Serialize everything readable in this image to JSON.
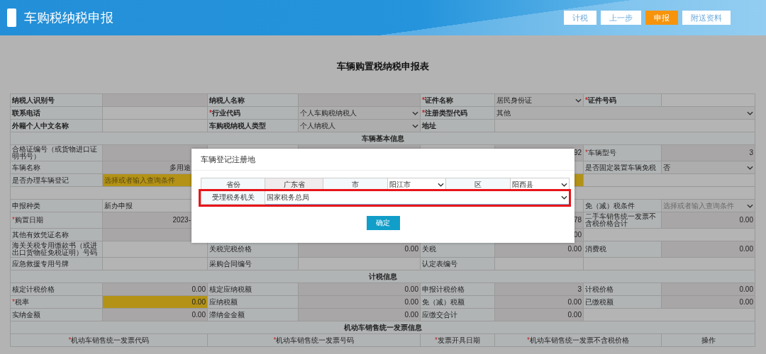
{
  "header": {
    "title": "车购税纳税申报",
    "buttons": [
      {
        "label": "计税",
        "primary": false
      },
      {
        "label": "上一步",
        "primary": false
      },
      {
        "label": "申报",
        "primary": true
      },
      {
        "label": "附送资料",
        "primary": false
      }
    ]
  },
  "form": {
    "title": "车辆购置税纳税申报表",
    "rows": [
      {
        "kind": "quad",
        "cells": [
          {
            "kind": "label",
            "text": "纳税人识别号",
            "bold": true
          },
          {
            "kind": "value",
            "readonly": true
          },
          {
            "kind": "label",
            "text": "纳税人名称",
            "bold": true
          },
          {
            "kind": "value",
            "readonly": true
          },
          {
            "kind": "label",
            "mark": "*",
            "text": "证件名称",
            "bold": true
          },
          {
            "kind": "dropdown",
            "text": "居民身份证"
          },
          {
            "kind": "label",
            "mark": "*",
            "text": "证件号码",
            "bold": true
          },
          {
            "kind": "value"
          }
        ]
      },
      {
        "kind": "tail3",
        "cells": [
          {
            "kind": "label",
            "text": "联系电话",
            "bold": true
          },
          {
            "kind": "value"
          },
          {
            "kind": "label",
            "mark": "*",
            "text": "行业代码",
            "bold": true
          },
          {
            "kind": "dropdown",
            "text": "个人车购税纳税人"
          },
          {
            "kind": "label",
            "mark": "*",
            "text": "注册类型代码",
            "bold": true
          },
          {
            "kind": "dropdown",
            "text": "其他"
          }
        ]
      },
      {
        "kind": "tail3",
        "cells": [
          {
            "kind": "label",
            "text": "外籍个人中文名称",
            "bold": true
          },
          {
            "kind": "value"
          },
          {
            "kind": "label",
            "text": "车购税纳税人类型",
            "bold": true
          },
          {
            "kind": "dropdown",
            "text": "个人纳税人"
          },
          {
            "kind": "label",
            "text": "地址",
            "bold": true
          },
          {
            "kind": "value"
          }
        ]
      },
      {
        "kind": "full",
        "cells": [
          {
            "kind": "section",
            "text": "车辆基本信息"
          }
        ]
      },
      {
        "kind": "quad",
        "cells": [
          {
            "kind": "label",
            "text": "合格证编号（或货物进口证明书号）"
          },
          {
            "kind": "value",
            "readonly": true
          },
          {
            "kind": "value"
          },
          {
            "kind": "value",
            "readonly": true
          },
          {
            "kind": "value"
          },
          {
            "kind": "value",
            "readonly": true,
            "text": "92"
          },
          {
            "kind": "label",
            "mark": "*",
            "text": "车辆型号"
          },
          {
            "kind": "value",
            "readonly": true,
            "text": "3"
          }
        ]
      },
      {
        "kind": "quad",
        "cells": [
          {
            "kind": "label",
            "text": "车辆名称"
          },
          {
            "kind": "value",
            "readonly": true,
            "text": "多用途",
            "under_dialog": true
          },
          {
            "kind": "value"
          },
          {
            "kind": "value"
          },
          {
            "kind": "value"
          },
          {
            "kind": "value"
          },
          {
            "kind": "label",
            "text": "是否固定装置车辆免税"
          },
          {
            "kind": "dropdown",
            "text": "否"
          }
        ]
      },
      {
        "kind": "wide_mid",
        "cells": [
          {
            "kind": "label",
            "text": "是否办理车辆登记"
          },
          {
            "kind": "value",
            "highlight": true,
            "placeholder": "选择或者输入查询条件"
          },
          {
            "kind": "value"
          }
        ]
      },
      {
        "kind": "full",
        "cells": [
          {
            "kind": "value"
          }
        ]
      },
      {
        "kind": "quad",
        "cells": [
          {
            "kind": "label",
            "text": "申报种类"
          },
          {
            "kind": "value",
            "text": "新办申报"
          },
          {
            "kind": "value"
          },
          {
            "kind": "value"
          },
          {
            "kind": "value"
          },
          {
            "kind": "value"
          },
          {
            "kind": "label",
            "text": "免（减）税条件"
          },
          {
            "kind": "dropdown",
            "placeholder": "选择或者输入查询条件"
          }
        ]
      },
      {
        "kind": "quad",
        "cells": [
          {
            "kind": "label",
            "mark": "*",
            "text": "购置日期"
          },
          {
            "kind": "value",
            "readonly": true,
            "text": "2023-",
            "under_dialog": true
          },
          {
            "kind": "value"
          },
          {
            "kind": "value"
          },
          {
            "kind": "value"
          },
          {
            "kind": "value",
            "readonly": true,
            "text": "78"
          },
          {
            "kind": "label",
            "text": "二手车销售统一发票不含税价格合计"
          },
          {
            "kind": "value",
            "readonly": true,
            "text": "0.00"
          }
        ]
      },
      {
        "kind": "tail2",
        "cells": [
          {
            "kind": "label",
            "text": "其他有效凭证名称"
          },
          {
            "kind": "value",
            "readonly": true
          },
          {
            "kind": "value"
          },
          {
            "kind": "value"
          },
          {
            "kind": "value"
          },
          {
            "kind": "value",
            "readonly": true,
            "text": "00"
          },
          {
            "kind": "value"
          }
        ]
      },
      {
        "kind": "quad",
        "cells": [
          {
            "kind": "label",
            "text": "海关关税专用缴款书（或进出口货物征免税证明）号码"
          },
          {
            "kind": "value"
          },
          {
            "kind": "label",
            "text": "关税完税价格"
          },
          {
            "kind": "value",
            "readonly": true,
            "text": "0.00"
          },
          {
            "kind": "label",
            "text": "关税"
          },
          {
            "kind": "value",
            "readonly": true,
            "text": "0.00"
          },
          {
            "kind": "label",
            "text": "消费税"
          },
          {
            "kind": "value",
            "readonly": true,
            "text": "0.00"
          }
        ]
      },
      {
        "kind": "tail2",
        "cells": [
          {
            "kind": "label",
            "text": "应急救援专用号牌"
          },
          {
            "kind": "value"
          },
          {
            "kind": "label",
            "text": "采购合同编号"
          },
          {
            "kind": "value"
          },
          {
            "kind": "label",
            "text": "认定表编号"
          },
          {
            "kind": "value"
          },
          {
            "kind": "value"
          }
        ]
      },
      {
        "kind": "full",
        "cells": [
          {
            "kind": "section",
            "text": "计税信息"
          }
        ]
      },
      {
        "kind": "quad",
        "cells": [
          {
            "kind": "label",
            "text": "核定计税价格"
          },
          {
            "kind": "value",
            "readonly": true,
            "text": "0.00"
          },
          {
            "kind": "label",
            "text": "核定应纳税额"
          },
          {
            "kind": "value",
            "readonly": true,
            "text": "0.00"
          },
          {
            "kind": "label",
            "text": "申报计税价格"
          },
          {
            "kind": "value",
            "readonly": true,
            "text": "3"
          },
          {
            "kind": "label",
            "text": "计税价格"
          },
          {
            "kind": "value",
            "readonly": true,
            "text": "0.00"
          }
        ]
      },
      {
        "kind": "quad",
        "cells": [
          {
            "kind": "label",
            "mark": "*",
            "text": "税率"
          },
          {
            "kind": "value",
            "readonly": true,
            "highlight": true,
            "text": "0.00"
          },
          {
            "kind": "label",
            "text": "应纳税额"
          },
          {
            "kind": "value",
            "readonly": true,
            "text": "0.00"
          },
          {
            "kind": "label",
            "text": "免（减）税额"
          },
          {
            "kind": "value",
            "readonly": true,
            "text": "0.00"
          },
          {
            "kind": "label",
            "text": "已缴税额"
          },
          {
            "kind": "value",
            "readonly": true,
            "text": "0.00"
          }
        ]
      },
      {
        "kind": "tail2",
        "cells": [
          {
            "kind": "label",
            "text": "实纳金额"
          },
          {
            "kind": "value",
            "readonly": true,
            "text": "0.00"
          },
          {
            "kind": "label",
            "text": "滞纳金金额"
          },
          {
            "kind": "value",
            "readonly": true,
            "text": "0.00"
          },
          {
            "kind": "label",
            "text": "应缴交合计"
          },
          {
            "kind": "value",
            "readonly": true,
            "text": "0.00"
          },
          {
            "kind": "value"
          }
        ]
      },
      {
        "kind": "full",
        "cells": [
          {
            "kind": "section",
            "text": "机动车销售统一发票信息"
          }
        ]
      }
    ],
    "invoice_table": {
      "columns": [
        {
          "mark": "*",
          "text": "机动车销售统一发票代码"
        },
        {
          "mark": "*",
          "text": "机动车销售统一发票号码"
        },
        {
          "mark": "*",
          "text": "发票开具日期"
        },
        {
          "mark": "*",
          "text": "机动车销售统一发票不含税价格"
        },
        {
          "text": "操作"
        }
      ]
    }
  },
  "dialog": {
    "title": "车辆登记注册地",
    "rows": [
      {
        "kind": "region",
        "cells": [
          {
            "kind": "label",
            "text": "省份"
          },
          {
            "kind": "value",
            "text": "广东省"
          },
          {
            "kind": "label",
            "text": "市"
          },
          {
            "kind": "dropdown",
            "text": "阳江市"
          },
          {
            "kind": "label",
            "text": "区"
          },
          {
            "kind": "dropdown",
            "text": "阳西县"
          }
        ]
      },
      {
        "kind": "office",
        "highlighted": true,
        "cells": [
          {
            "kind": "label",
            "text": "受理税务机关"
          },
          {
            "kind": "dropdown",
            "text": "国家税务总局",
            "focused": true
          }
        ]
      }
    ],
    "button": "确定"
  }
}
